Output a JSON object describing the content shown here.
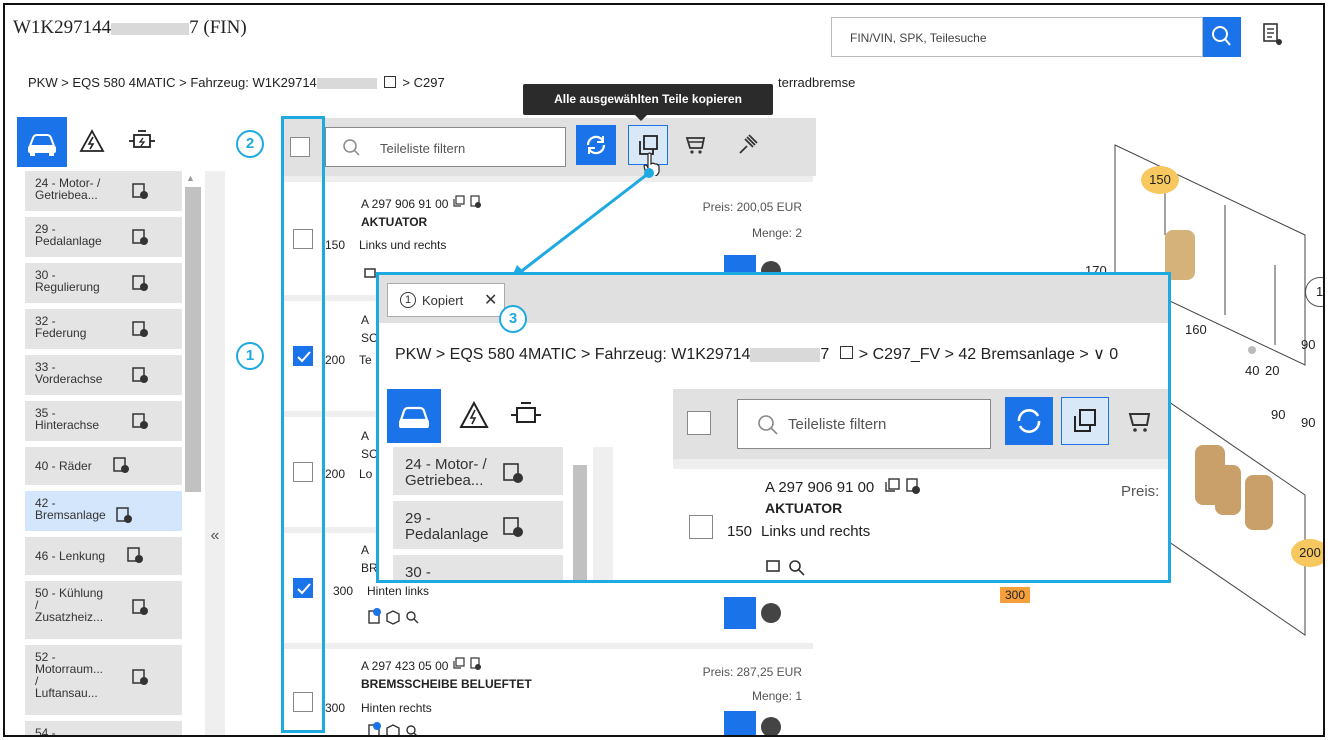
{
  "header": {
    "title_prefix": "W1K297144",
    "title_suffix": "7 (FIN)",
    "search_placeholder": "FIN/VIN, SPK, Teilesuche"
  },
  "breadcrumb": {
    "part1": "PKW > EQS 580 4MATIC > Fahrzeug: W1K29714",
    "part2": "> C297",
    "part3": "terradbremse"
  },
  "tooltip": "Alle ausgewählten Teile kopieren",
  "sidebar": {
    "items": [
      {
        "label_1": "24 - Motor- /",
        "label_2": "Getriebea..."
      },
      {
        "label_1": "29 -",
        "label_2": "Pedalanlage"
      },
      {
        "label_1": "30 -",
        "label_2": "Regulierung"
      },
      {
        "label_1": "32 -",
        "label_2": "Federung"
      },
      {
        "label_1": "33 -",
        "label_2": "Vorderachse"
      },
      {
        "label_1": "35 -",
        "label_2": "Hinterachse"
      },
      {
        "label_1": "40 - Räder",
        "label_2": ""
      },
      {
        "label_1": "42 -",
        "label_2": "Bremsanlage"
      },
      {
        "label_1": "46 - Lenkung",
        "label_2": ""
      },
      {
        "label_1": "50 - Kühlung",
        "label_2": "/",
        "label_3": "Zusatzheiz..."
      },
      {
        "label_1": "52 -",
        "label_2": "Motorraum...",
        "label_3": "/",
        "label_4": "Luftansau..."
      },
      {
        "label_1": "54 -",
        "label_2": ""
      }
    ],
    "collapse": "«"
  },
  "toolbar": {
    "filter_placeholder": "Teileliste filtern"
  },
  "parts": [
    {
      "number": "A 297 906 91 00",
      "name": "AKTUATOR",
      "desc": "Links und rechts",
      "pos": "150",
      "price": "Preis: 200,05 EUR",
      "qty": "Menge: 2"
    },
    {
      "number": "A",
      "name": "SC",
      "desc": "Te",
      "pos": "200"
    },
    {
      "number": "A",
      "name": "SC",
      "desc": "Lo",
      "pos": "200"
    },
    {
      "number": "A",
      "name": "BR",
      "desc": "Hinten links",
      "pos": "300"
    },
    {
      "number": "A 297 423 05 00",
      "name": "BREMSSCHEIBE BELUEFTET",
      "desc": "Hinten rechts",
      "pos": "300",
      "price": "Preis: 287,25 EUR",
      "qty": "Menge: 1"
    }
  ],
  "callouts": [
    "1",
    "2",
    "3"
  ],
  "zoom": {
    "kopiert_label": "Kopiert",
    "kopiert_count": "1",
    "breadcrumb": "PKW > EQS 580 4MATIC > Fahrzeug: W1K29714",
    "breadcrumb_end": "7",
    "breadcrumb_tail": "> C297_FV > 42 Bremsanlage > ∨ 0",
    "filter_placeholder": "Teileliste filtern",
    "items": [
      {
        "label_1": "24 - Motor- /",
        "label_2": "Getriebea..."
      },
      {
        "label_1": "29 -",
        "label_2": "Pedalanlage"
      },
      {
        "label_1": "30 -",
        "label_2": ""
      }
    ],
    "part": {
      "number": "A 297 906 91 00",
      "name": "AKTUATOR",
      "desc": "Links und rechts",
      "pos": "150",
      "price": "Preis:"
    }
  },
  "diagram": {
    "labels": [
      "150",
      "170",
      "160",
      "40",
      "20",
      "90",
      "90",
      "90",
      "200",
      "300",
      "1"
    ]
  },
  "colors": {
    "accent": "#1a73e8",
    "callout": "#1ea9e0",
    "badge_yellow": "#f6c85f",
    "badge_orange": "#f5a03c"
  }
}
